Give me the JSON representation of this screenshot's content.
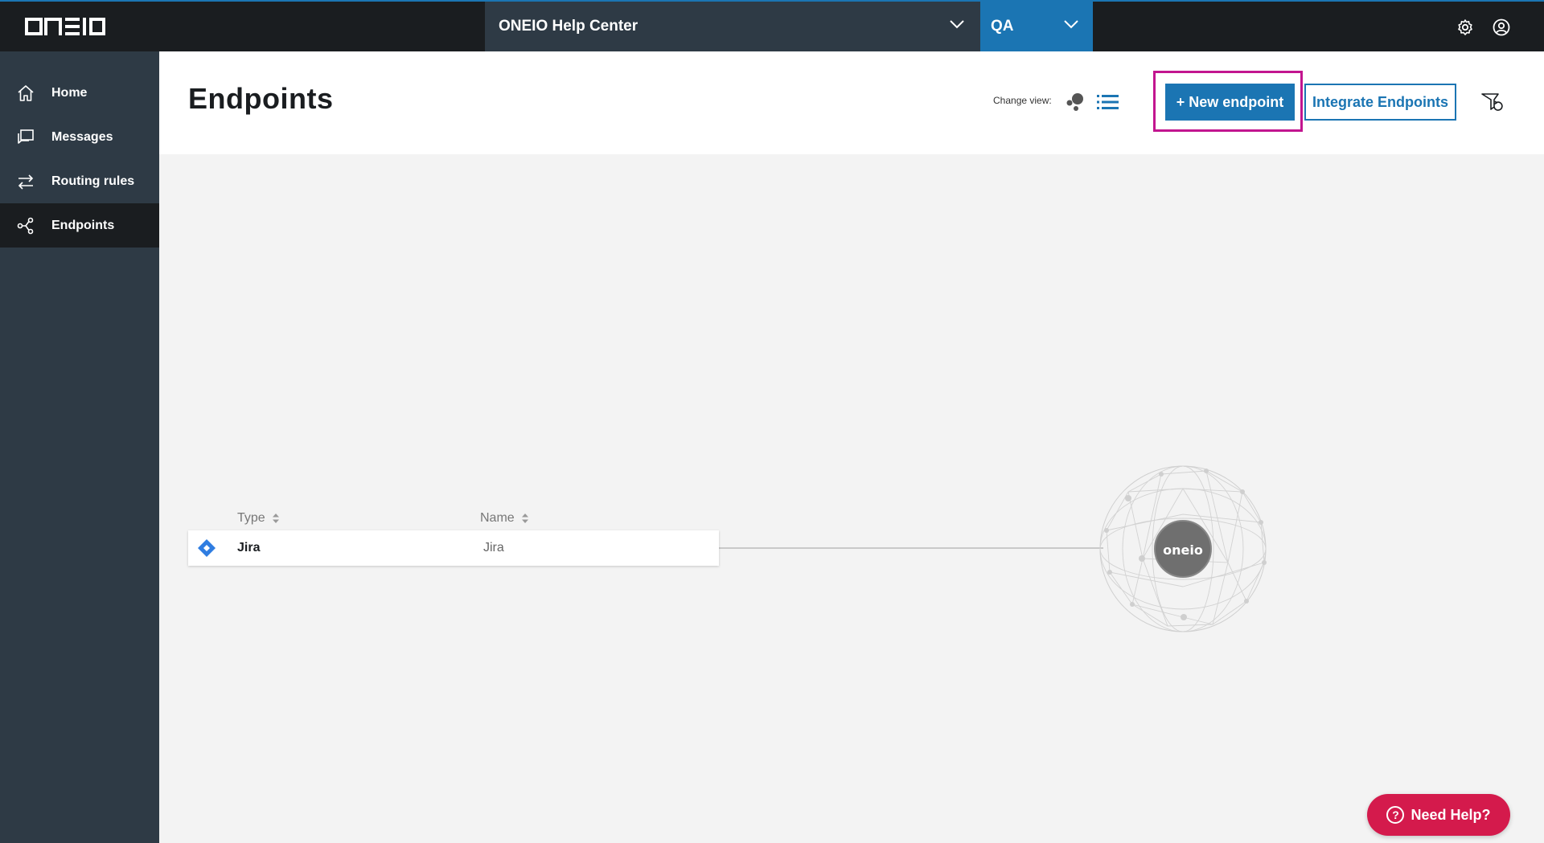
{
  "app": {
    "logo_text": "ONEIO",
    "organization": "ONEIO Help Center",
    "environment": "QA"
  },
  "sidebar": {
    "items": [
      {
        "label": "Home",
        "icon": "home-icon",
        "active": false
      },
      {
        "label": "Messages",
        "icon": "messages-icon",
        "active": false
      },
      {
        "label": "Routing rules",
        "icon": "routing-icon",
        "active": false
      },
      {
        "label": "Endpoints",
        "icon": "endpoints-icon",
        "active": true
      }
    ]
  },
  "header": {
    "title": "Endpoints",
    "change_view_label": "Change view:",
    "new_endpoint_label": "+ New endpoint",
    "integrate_label": "Integrate Endpoints"
  },
  "table": {
    "columns": [
      "Type",
      "Name"
    ],
    "rows": [
      {
        "type": "Jira",
        "name": "Jira",
        "icon": "jira-icon"
      }
    ]
  },
  "graph": {
    "hub_label": "oneio"
  },
  "help": {
    "label": "Need Help?"
  },
  "colors": {
    "accent": "#1b75b3",
    "sidebar": "#2e3a45",
    "topbar": "#1a1d20",
    "highlight": "#c2158f",
    "help": "#d41a4c"
  }
}
